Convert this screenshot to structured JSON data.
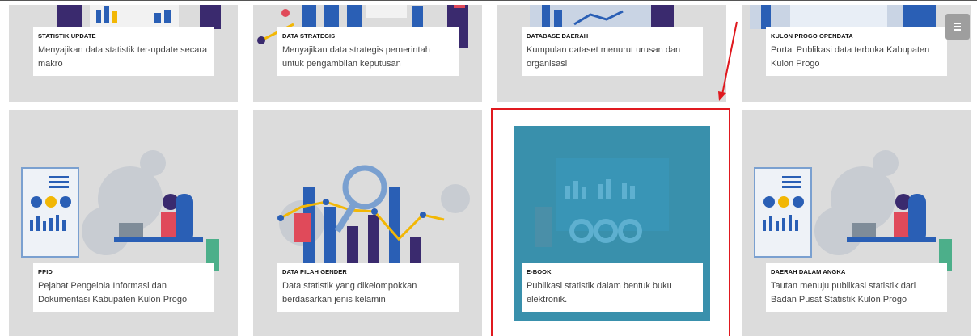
{
  "cards": [
    {
      "title": "STATISTIK UPDATE",
      "desc": "Menyajikan data statistik ter-update secara makro"
    },
    {
      "title": "DATA STRATEGIS",
      "desc": "Menyajikan data strategis pemerintah untuk pengambilan keputusan"
    },
    {
      "title": "DATABASE DAERAH",
      "desc": "Kumpulan dataset menurut urusan dan organisasi"
    },
    {
      "title": "KULON PROGO OPENDATA",
      "desc": "Portal Publikasi data terbuka Kabupaten Kulon Progo"
    },
    {
      "title": "PPID",
      "desc": "Pejabat Pengelola Informasi dan Dokumentasi Kabupaten Kulon Progo"
    },
    {
      "title": "DATA PILAH GENDER",
      "desc": "Data statistik yang dikelompokkan berdasarkan jenis kelamin"
    },
    {
      "title": "E-BOOK",
      "desc": "Publikasi statistik dalam bentuk buku elektronik."
    },
    {
      "title": "DAERAH DALAM ANGKA",
      "desc": "Tautan menuju publikasi statistik dari Badan Pusat Statistik Kulon Progo"
    }
  ],
  "colors": {
    "card_bg": "#dcdcdc",
    "highlight": "#e0191f",
    "ebook_overlay": "#2887a5",
    "menu_button": "#9e9e9e"
  },
  "icons": {
    "menu": "hamburger-icon"
  }
}
